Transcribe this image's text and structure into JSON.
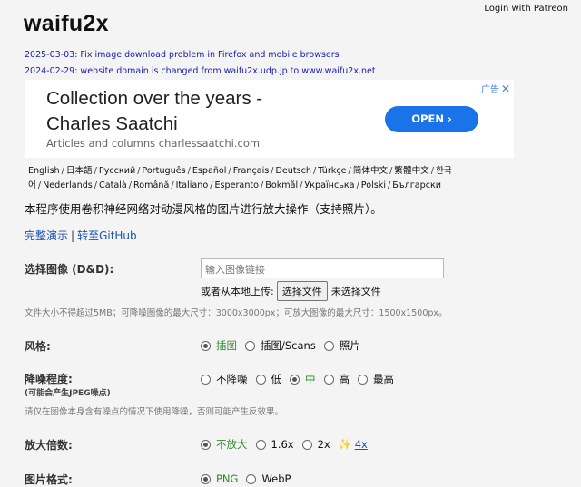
{
  "header": {
    "login": "Login with Patreon",
    "logo": "waifu2x"
  },
  "news": [
    "2025-03-03: Fix image download problem in Firefox and mobile browsers",
    "2024-02-29: website domain is changed from waifu2x.udp.jp to www.waifu2x.net"
  ],
  "ad": {
    "title_line1": "Collection over the years -",
    "title_line2": "Charles Saatchi",
    "subtitle": "Articles and columns charlessaatchi.com",
    "button": "OPEN",
    "tag": "广告",
    "close": "✕"
  },
  "languages": [
    "English",
    "日本語",
    "Русский",
    "Português",
    "Español",
    "Français",
    "Deutsch",
    "Türkçe",
    "简体中文",
    "繁體中文",
    "한국어",
    "Nederlands",
    "Català",
    "Română",
    "Italiano",
    "Esperanto",
    "Bokmål",
    "Українська",
    "Polski",
    "Български"
  ],
  "intro": "本程序使用卷积神经网络对动漫风格的图片进行放大操作（支持照片）。",
  "links": {
    "demo": "完整演示",
    "separator": "|",
    "github": "转至GitHub"
  },
  "form": {
    "image_label": "选择图像 (D&D):",
    "url_placeholder": "输入图像链接",
    "upload_prefix": "或者从本地上传:",
    "file_button": "选择文件",
    "file_status": "未选择文件",
    "size_hint": "文件大小不得超过5MB；可降噪图像的最大尺寸：3000x3000px；可放大图像的最大尺寸：1500x1500px。",
    "style": {
      "label": "风格:",
      "options": [
        "插图",
        "插图/Scans",
        "照片"
      ],
      "selected": 0
    },
    "noise": {
      "label": "降噪程度:",
      "sublabel": "(可能会产生JPEG噪点)",
      "options": [
        "不降噪",
        "低",
        "中",
        "高",
        "最高"
      ],
      "selected": 2,
      "hint": "请仅在图像本身含有噪点的情况下使用降噪，否则可能产生反效果。"
    },
    "scale": {
      "label": "放大倍数:",
      "options": [
        "不放大",
        "1.6x",
        "2x",
        "4x"
      ],
      "selected": 0
    },
    "format": {
      "label": "图片格式:",
      "options": [
        "PNG",
        "WebP"
      ],
      "selected": 0
    }
  }
}
